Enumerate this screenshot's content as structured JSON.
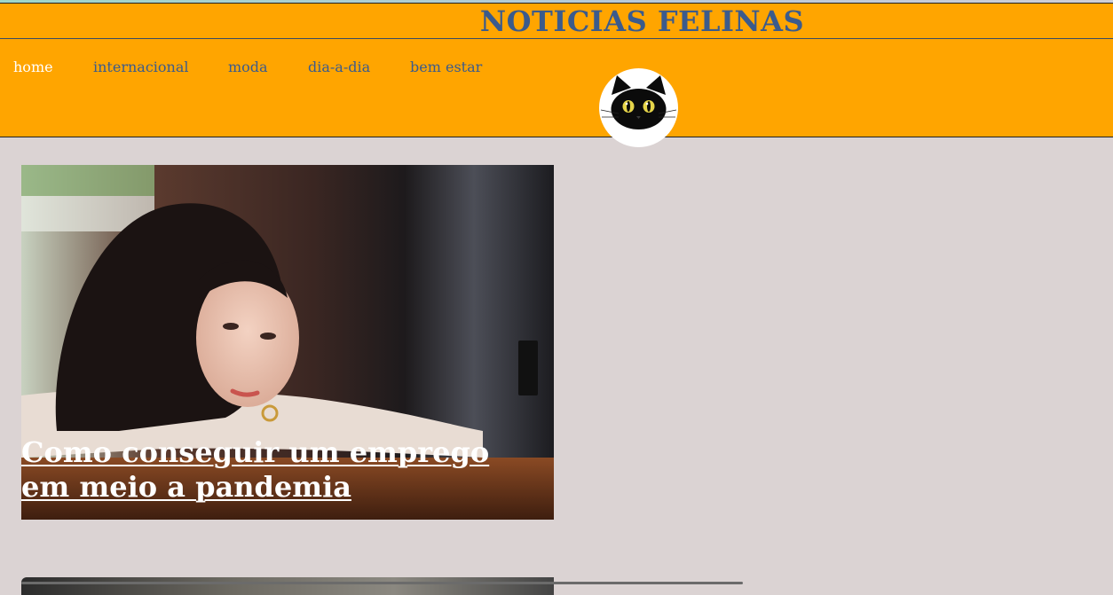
{
  "site": {
    "title": "NOTICIAS FELINAS"
  },
  "nav": {
    "items": [
      {
        "label": "home",
        "active": true
      },
      {
        "label": "internacional",
        "active": false
      },
      {
        "label": "moda",
        "active": false
      },
      {
        "label": "dia-a-dia",
        "active": false
      },
      {
        "label": "bem estar",
        "active": false
      }
    ]
  },
  "logo": {
    "icon": "black-cat-face-icon"
  },
  "articles": [
    {
      "headline": "Como conseguir um emprego em meio a pandemia",
      "image": "woman-resting-on-arms-photo"
    }
  ],
  "colors": {
    "header_bg": "#ffa500",
    "title": "#3b5b8c",
    "nav_active": "#ffffff",
    "page_bg": "#dbd3d3"
  }
}
